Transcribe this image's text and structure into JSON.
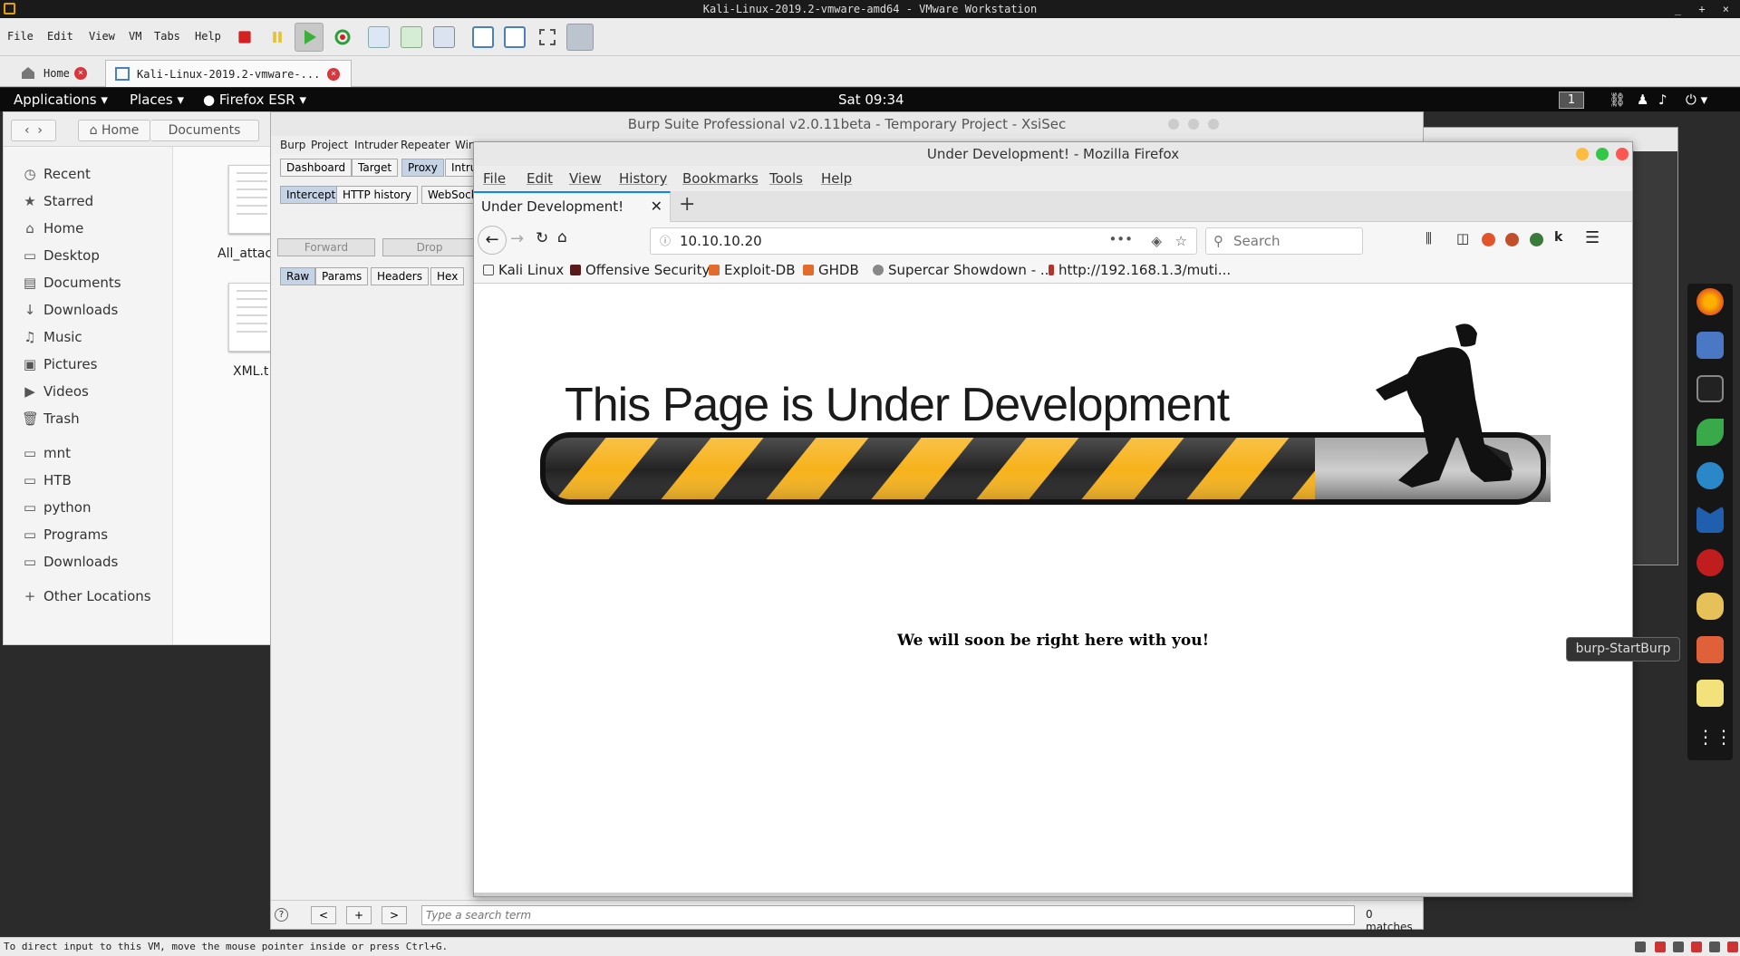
{
  "vmware": {
    "title": "Kali-Linux-2019.2-vmware-amd64 - VMware Workstation",
    "menu": [
      "File",
      "Edit",
      "View",
      "VM",
      "Tabs",
      "Help"
    ],
    "tabs": [
      {
        "label": "Home"
      },
      {
        "label": "Kali-Linux-2019.2-vmware-..."
      }
    ],
    "status": "To direct input to this VM, move the mouse pointer inside or press Ctrl+G."
  },
  "kali_panel": {
    "applications": "Applications",
    "places": "Places",
    "firefox": "Firefox ESR",
    "clock": "Sat 09:34",
    "workspace": "1"
  },
  "files": {
    "path": [
      "Home",
      "Documents"
    ],
    "sidebar": [
      "Recent",
      "Starred",
      "Home",
      "Desktop",
      "Documents",
      "Downloads",
      "Music",
      "Pictures",
      "Videos",
      "Trash",
      "mnt",
      "HTB",
      "python",
      "Programs",
      "Downloads"
    ],
    "other_locations": "Other Locations",
    "file1": "All_attac",
    "file2": "XML.t"
  },
  "burp": {
    "title": "Burp Suite Professional v2.0.11beta - Temporary Project - XsiSec",
    "menu": [
      "Burp",
      "Project",
      "Intruder",
      "Repeater",
      "Win"
    ],
    "tabs": [
      "Dashboard",
      "Target",
      "Proxy",
      "Intru"
    ],
    "subtabs": [
      "Intercept",
      "HTTP history",
      "WebSock"
    ],
    "forward": "Forward",
    "drop": "Drop",
    "msgtabs": [
      "Raw",
      "Params",
      "Headers",
      "Hex"
    ],
    "search_placeholder": "Type a search term",
    "matches": "0 matches",
    "help": "?",
    "prev": "<",
    "plus": "+",
    "next": ">"
  },
  "firefox": {
    "title": "Under Development! - Mozilla Firefox",
    "menu": [
      "File",
      "Edit",
      "View",
      "History",
      "Bookmarks",
      "Tools",
      "Help"
    ],
    "tab": "Under Development!",
    "url": "10.10.10.20",
    "search_placeholder": "Search",
    "bookmarks": [
      "Kali Linux",
      "Offensive Security",
      "Exploit-DB",
      "GHDB",
      "Supercar Showdown - ...",
      "http://192.168.1.3/muti..."
    ],
    "heading": "This Page is Under Development",
    "message": "We will soon be right here with you!"
  },
  "dock": {
    "tooltip": "burp-StartBurp"
  },
  "colors": {
    "stripe_yellow": "#f7b21a",
    "firefox_accent": "#0a84ff",
    "close_red": "#fc5753",
    "min_yellow": "#fdbc40",
    "max_green": "#33c748"
  }
}
